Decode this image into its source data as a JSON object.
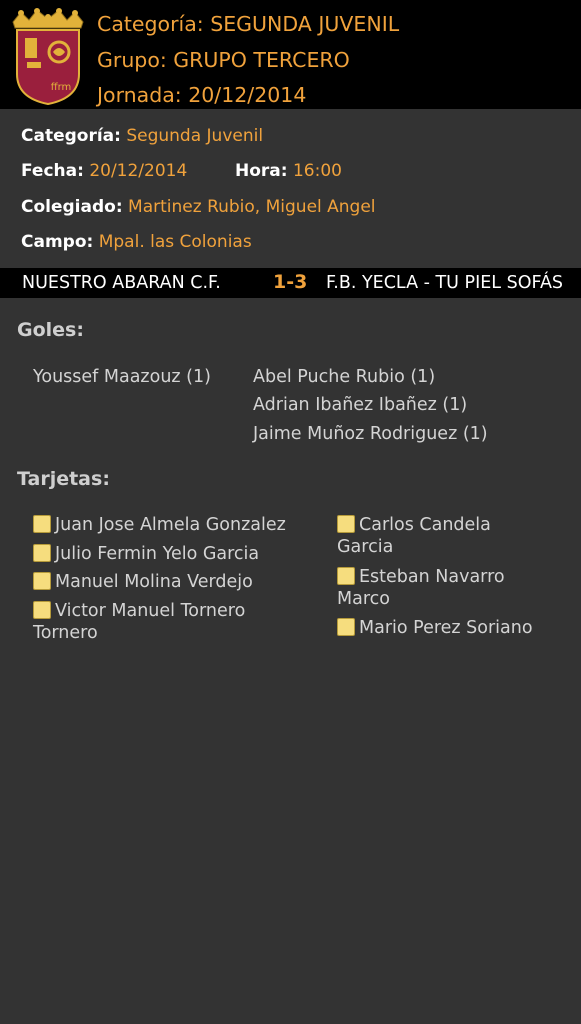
{
  "header": {
    "logo_text": "ffrm",
    "categoria_line": "Categoría: SEGUNDA JUVENIL",
    "grupo_line": "Grupo: GRUPO TERCERO",
    "jornada_line": "Jornada: 20/12/2014"
  },
  "info": {
    "categoria_label": "Categoría:",
    "categoria_value": "Segunda Juvenil",
    "fecha_label": "Fecha:",
    "fecha_value": "20/12/2014",
    "hora_label": "Hora:",
    "hora_value": "16:00",
    "colegiado_label": "Colegiado:",
    "colegiado_value": "Martinez Rubio, Miguel Angel",
    "campo_label": "Campo:",
    "campo_value": "Mpal. las Colonias"
  },
  "match": {
    "home": "NUESTRO ABARAN C.F.",
    "score": "1-3",
    "away": "F.B. YECLA - TU PIEL SOFÁS"
  },
  "goals": {
    "title": "Goles:",
    "home": [
      "Youssef Maazouz  (1)"
    ],
    "away": [
      "Abel Puche Rubio (1)",
      "Adrian Ibañez Ibañez (1)",
      "Jaime Muñoz Rodriguez (1)"
    ]
  },
  "cards": {
    "title": "Tarjetas:",
    "card_icon": "yellow-card-icon",
    "card_color": "#f6dd7e",
    "home": [
      "Juan Jose Almela Gonzalez",
      "Julio Fermin Yelo Garcia",
      "Manuel Molina Verdejo",
      "Victor Manuel Tornero Tornero"
    ],
    "away": [
      "Carlos Candela Garcia",
      "Esteban Navarro Marco",
      "Mario Perez Soriano"
    ]
  },
  "colors": {
    "accent": "#f0a23c",
    "background": "#333333",
    "bar": "#000000"
  }
}
